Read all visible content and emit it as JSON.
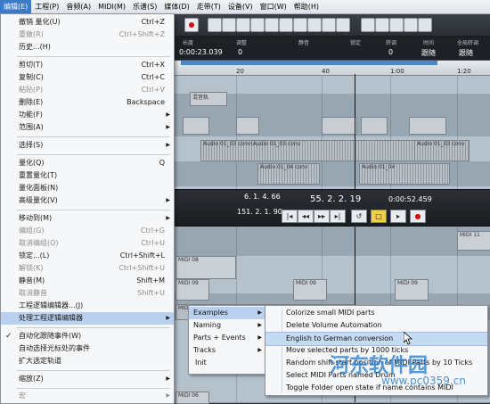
{
  "menubar": [
    "编辑(E)",
    "工程(P)",
    "音频(A)",
    "MIDI(M)",
    "乐谱(S)",
    "媒体(D)",
    "走带(T)",
    "设备(V)",
    "窗口(W)",
    "帮助(H)"
  ],
  "info": {
    "h1": "长度",
    "h2": "调整",
    "h3": "静音",
    "h4": "锁定",
    "h5": "转调",
    "h6": "时间",
    "h7": "全局转调",
    "v1": "0:00:23.039",
    "v2": "0",
    "v3": "",
    "v4": "",
    "v5": "0",
    "v6": "跟随",
    "v7": "跟随"
  },
  "ruler_ticks": [
    "20",
    "40",
    "1:00",
    "1:20"
  ],
  "parts": {
    "p_title": "混音轨",
    "audio1": "Audio 01_03 conv(Audio 01_03 conv",
    "audio1b": "Audio 01_03 conv",
    "audio2": "Audio 01_04 conv",
    "audio2b": "Audio 01_04",
    "midi08": "MIDI 08",
    "midi09a": "MIDI 09",
    "midi09b": "MIDI 09",
    "midi09c": "MIDI 09",
    "midi11": "MIDI 11",
    "midi02": "MIDI 02",
    "midi06": "MIDI 06"
  },
  "transport": {
    "pos1": "6. 1. 4. 66",
    "pos2": "151. 2. 1. 90",
    "bars": "55. 2. 2. 19",
    "time": "0:00:52.459"
  },
  "edit_menu": [
    {
      "label": "撤销 量化(U)",
      "sc": "Ctrl+Z"
    },
    {
      "label": "重做(R)",
      "sc": "Ctrl+Shift+Z"
    },
    {
      "label": "历史...(H)",
      "sc": ""
    },
    {
      "label": "剪切(T)",
      "sc": "Ctrl+X"
    },
    {
      "label": "复制(C)",
      "sc": "Ctrl+C"
    },
    {
      "label": "粘贴(P)",
      "sc": "Ctrl+V"
    },
    {
      "label": "删除(E)",
      "sc": "Backspace"
    },
    {
      "label": "功能(F)",
      "sc": ""
    },
    {
      "label": "范围(A)",
      "sc": ""
    },
    {
      "label": "选择(S)",
      "sc": ""
    },
    {
      "label": "量化(Q)",
      "sc": "Q"
    },
    {
      "label": "重置量化(T)",
      "sc": ""
    },
    {
      "label": "量化面板(N)",
      "sc": ""
    },
    {
      "label": "高级量化(V)",
      "sc": ""
    },
    {
      "label": "移动到(M)",
      "sc": ""
    },
    {
      "label": "编组(G)",
      "sc": "Ctrl+G"
    },
    {
      "label": "取消编组(O)",
      "sc": "Ctrl+U"
    },
    {
      "label": "锁定...(L)",
      "sc": "Ctrl+Shift+L"
    },
    {
      "label": "解锁(K)",
      "sc": "Ctrl+Shift+U"
    },
    {
      "label": "静音(M)",
      "sc": "Shift+M"
    },
    {
      "label": "取消静音",
      "sc": "Shift+U"
    },
    {
      "label": "工程逻辑编辑器...(J)",
      "sc": ""
    },
    {
      "label": "处理工程逻辑编辑器",
      "sc": ""
    },
    {
      "label": "自动化跟随事件(W)",
      "sc": ""
    },
    {
      "label": "自动选择光标处的事件",
      "sc": ""
    },
    {
      "label": "扩大选定轨道",
      "sc": ""
    },
    {
      "label": "缩放(Z)",
      "sc": ""
    },
    {
      "label": "宏",
      "sc": ""
    }
  ],
  "check": "✓",
  "submenu": [
    "Examples",
    "Naming",
    "Parts + Events",
    "Tracks",
    "Init"
  ],
  "examples": [
    "Colorize small MIDI parts",
    "Delete Volume Automation",
    "English to German conversion",
    "Move selected parts by 1000 ticks",
    "Random shift start position of MIDI Parts by 10 Ticks",
    "Select MIDI Parts named Drum",
    "Toggle Folder open state if name contains MIDI"
  ],
  "watermark": {
    "title": "河东软件园",
    "url": "www.pc0359.cn"
  },
  "colors": {
    "highlight": "#b9d1ee",
    "menubar_active": "#3b7ac9",
    "record": "#d10e0e"
  }
}
